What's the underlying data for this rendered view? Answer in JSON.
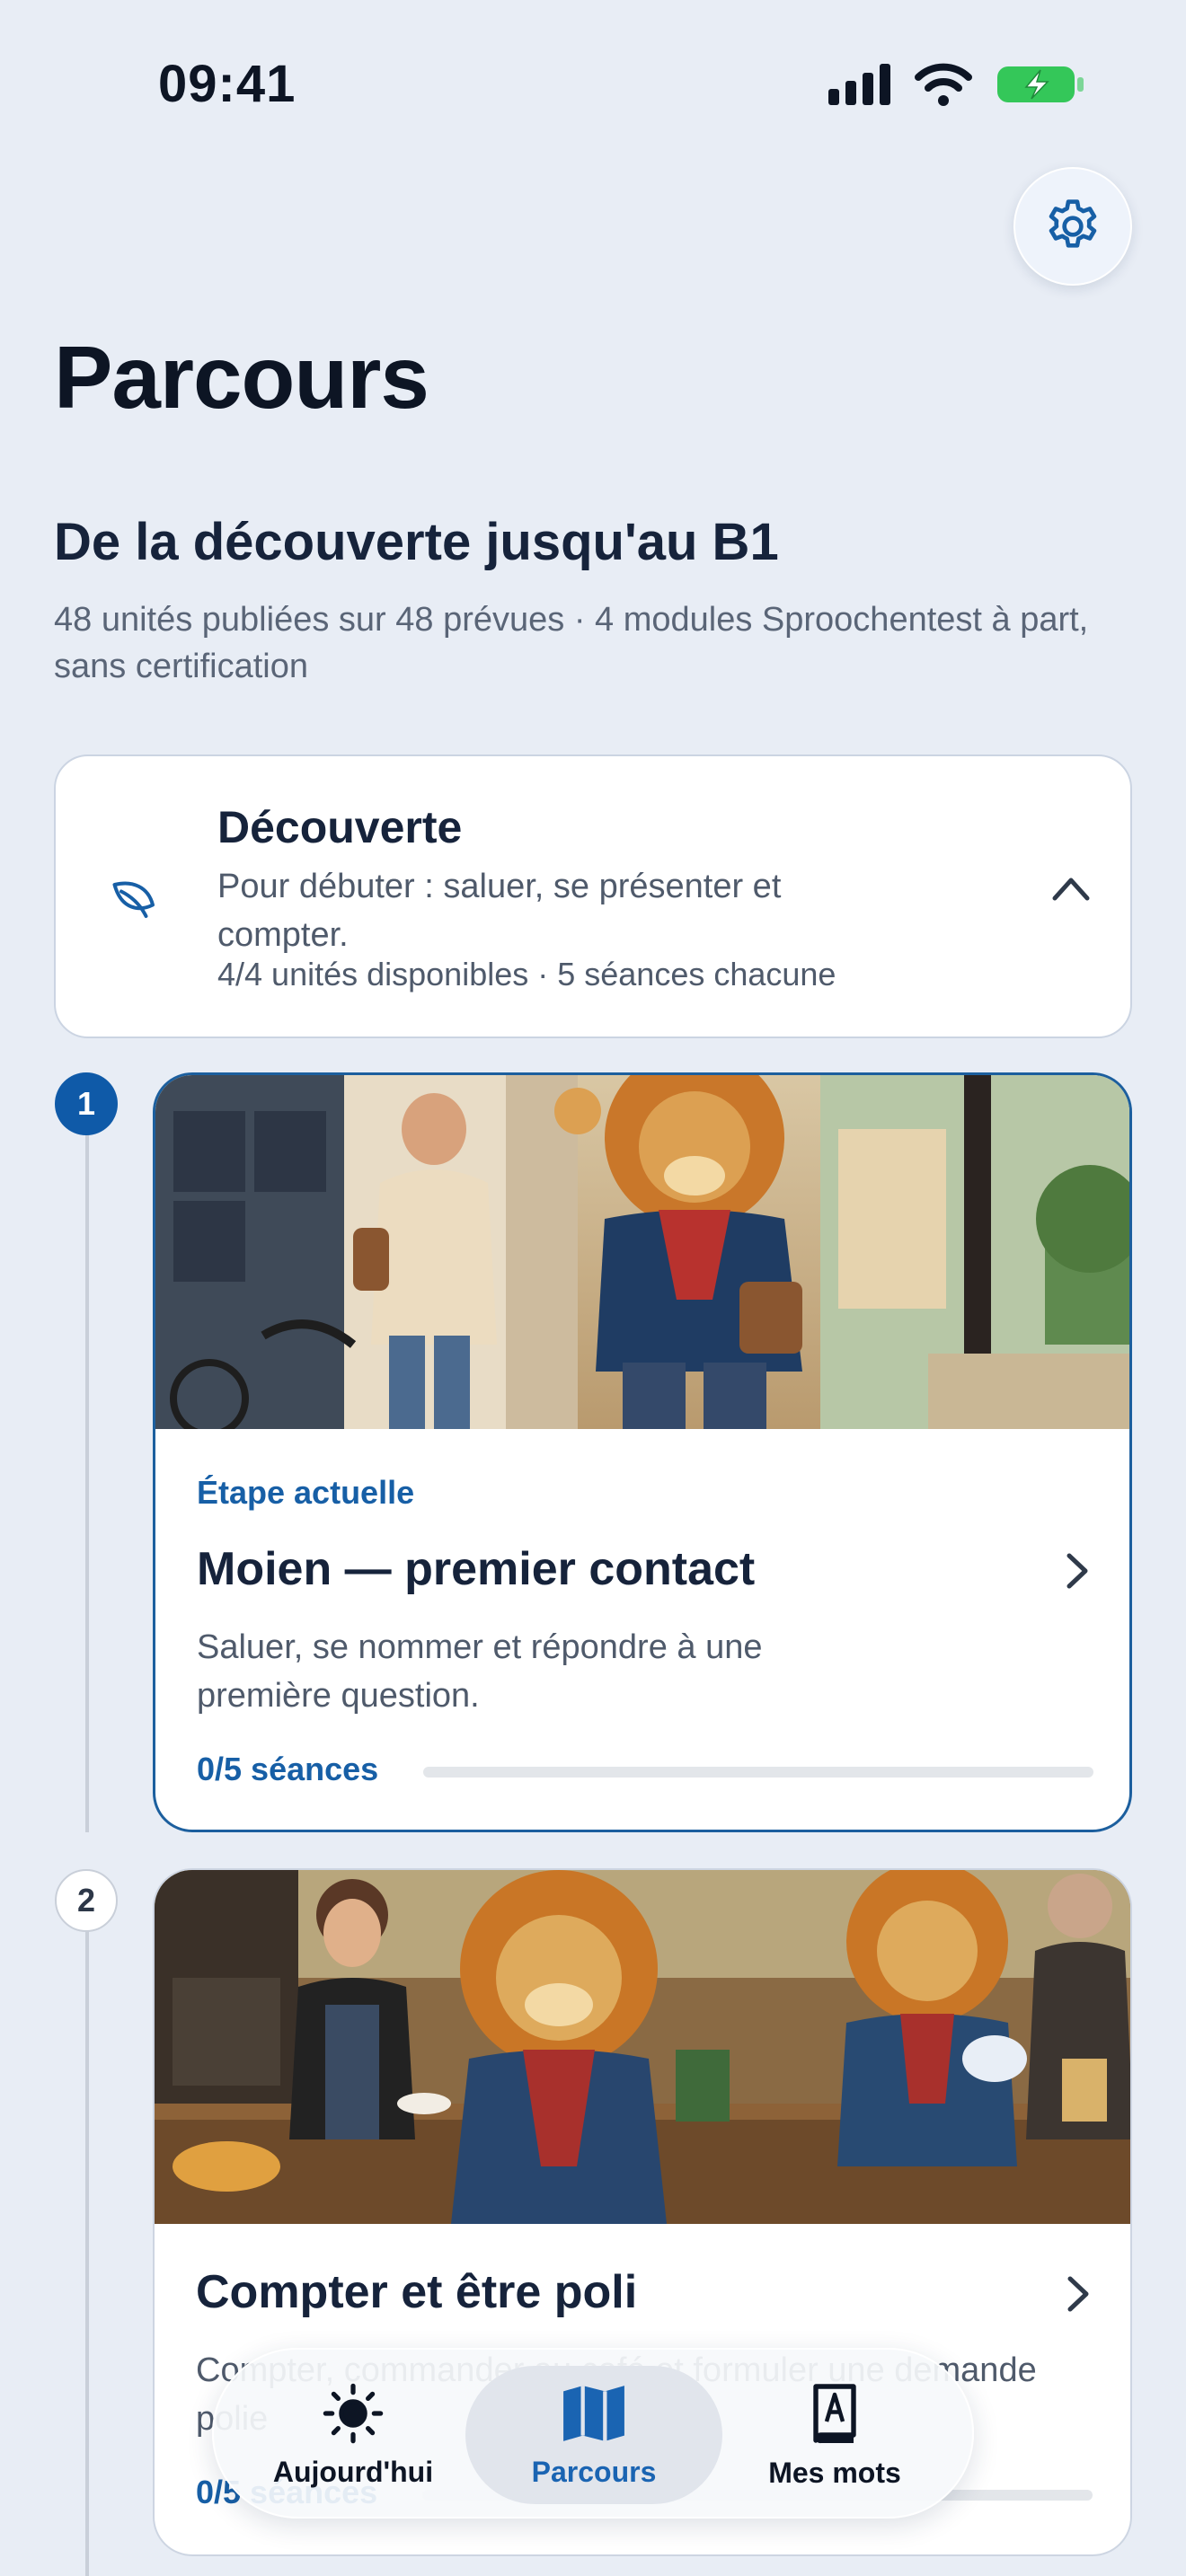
{
  "status": {
    "time": "09:41"
  },
  "header": {
    "title": "Parcours"
  },
  "path": {
    "title": "De la découverte jusqu'au B1",
    "subtitle": "48 unités publiées sur 48 prévues · 4 modules Sproochentest à part, sans certification"
  },
  "module": {
    "title": "Découverte",
    "description": "Pour débuter : saluer, se présenter et compter.",
    "meta": "4/4 unités disponibles · 5 séances chacune"
  },
  "units": [
    {
      "step": "1",
      "label": "Étape actuelle",
      "title": "Moien — premier contact",
      "description": "Saluer, se nommer et répondre à une première question.",
      "progress_label": "0/5 séances",
      "progress": 0
    },
    {
      "step": "2",
      "title": "Compter et être poli",
      "description": "Compter, commander au café et formuler une demande polie",
      "progress_label": "0/5 séances",
      "progress": 0
    }
  ],
  "tabs": [
    {
      "label": "Aujourd'hui",
      "icon": "sun-icon"
    },
    {
      "label": "Parcours",
      "icon": "map-icon",
      "active": true
    },
    {
      "label": "Mes mots",
      "icon": "dictionary-icon"
    }
  ],
  "colors": {
    "accent": "#0f5aa8",
    "background": "#e8edf5",
    "text": "#16233b"
  }
}
